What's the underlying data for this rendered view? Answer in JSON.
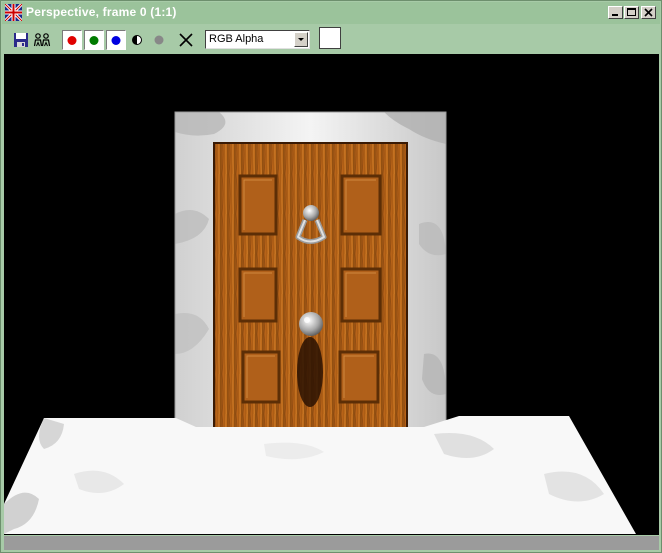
{
  "window": {
    "title": "Perspective, frame 0 (1:1)",
    "icon": "union-jack-icon",
    "controls": [
      "minimize-icon",
      "maximize-icon",
      "close-icon"
    ]
  },
  "toolbar": {
    "buttons": [
      {
        "name": "save-image",
        "icon": "floppy-disk-icon"
      },
      {
        "name": "clone-window",
        "icon": "people-icon"
      },
      {
        "name": "red-channel",
        "icon": "red-dot-icon",
        "color": "#e00000",
        "pressed": true
      },
      {
        "name": "green-channel",
        "icon": "green-dot-icon",
        "color": "#007a00",
        "pressed": true
      },
      {
        "name": "blue-channel",
        "icon": "blue-dot-icon",
        "color": "#0000e0",
        "pressed": true
      },
      {
        "name": "mono-toggle",
        "icon": "half-circle-icon"
      },
      {
        "name": "alpha-channel",
        "icon": "gray-dot-icon",
        "color": "#888888"
      },
      {
        "name": "clear",
        "icon": "x-icon"
      }
    ],
    "channel_select": {
      "value": "RGB Alpha"
    },
    "background_swatch": {
      "color": "#ffffff"
    }
  },
  "colors": {
    "frame": "#a7caa7",
    "titlebar": "#9bc39b",
    "viewport_bg": "#000000"
  },
  "viewport": {
    "content": "rendered door scene",
    "scene_icons": [
      "door-icon",
      "knocker-icon",
      "doorknob-icon"
    ]
  }
}
